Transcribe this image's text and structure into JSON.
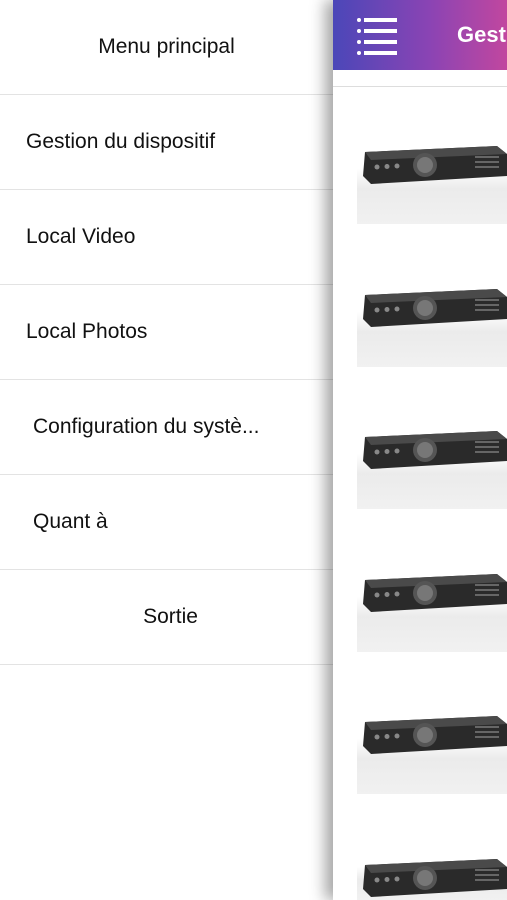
{
  "drawer": {
    "title": "Menu principal",
    "items": [
      {
        "label": "Gestion du dispositif"
      },
      {
        "label": "Local Video"
      },
      {
        "label": "Local Photos"
      },
      {
        "label": "Configuration du systè..."
      },
      {
        "label": "Quant à"
      },
      {
        "label": "Sortie"
      }
    ]
  },
  "navbar": {
    "title": "Gest",
    "menu_icon": "hamburger-menu-icon",
    "gradient_colors": [
      "#4b47b8",
      "#8a44b4",
      "#c1479f"
    ]
  },
  "devices": [
    {
      "icon": "dvr-device-icon"
    },
    {
      "icon": "dvr-device-icon"
    },
    {
      "icon": "dvr-device-icon"
    },
    {
      "icon": "dvr-device-icon"
    },
    {
      "icon": "dvr-device-icon"
    },
    {
      "icon": "dvr-device-icon"
    }
  ]
}
